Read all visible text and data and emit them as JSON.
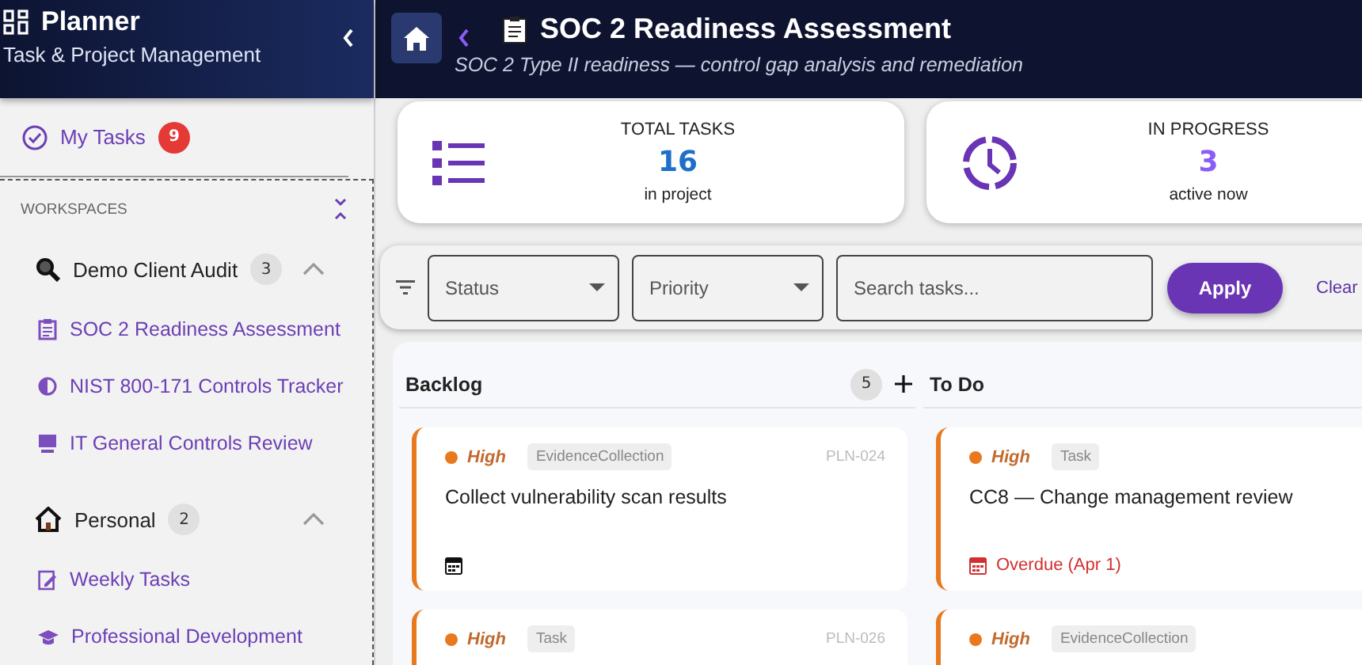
{
  "sidebar": {
    "title": "Planner",
    "subtitle": "Task & Project Management",
    "my_tasks": {
      "label": "My Tasks",
      "count": "9"
    },
    "section_label": "WORKSPACES",
    "workspaces": [
      {
        "name": "Demo Client Audit",
        "kind": "magnifier",
        "count": "3",
        "expanded": true,
        "children": [
          {
            "name": "SOC 2 Readiness Assessment",
            "kind": "clipboard"
          },
          {
            "name": "NIST 800-171 Controls Tracker",
            "kind": "half"
          },
          {
            "name": "IT General Controls Review",
            "kind": "monitor"
          }
        ]
      },
      {
        "name": "Personal",
        "kind": "house",
        "count": "2",
        "expanded": true,
        "children": [
          {
            "name": "Weekly Tasks",
            "kind": "edit"
          },
          {
            "name": "Professional Development",
            "kind": "cap"
          }
        ]
      }
    ]
  },
  "header": {
    "title": "SOC 2 Readiness Assessment",
    "subtitle": "SOC 2 Type II readiness — control gap analysis and remediation"
  },
  "stats": [
    {
      "kind": "list",
      "label": "TOTAL TASKS",
      "value": "16",
      "caption": "in project"
    },
    {
      "kind": "clock",
      "label": "IN PROGRESS",
      "value": "3",
      "caption": "active now"
    }
  ],
  "filters": {
    "status": {
      "placeholder": "Status"
    },
    "priority": {
      "placeholder": "Priority"
    },
    "search": {
      "placeholder": "Search tasks..."
    },
    "apply": "Apply",
    "clear": "Clear"
  },
  "columns": [
    {
      "title": "Backlog",
      "count": "5",
      "cards": [
        {
          "priority": "High",
          "tag": "EvidenceCollection",
          "id": "PLN-024",
          "title": "Collect vulnerability scan results",
          "kind": "dated"
        },
        {
          "priority": "High",
          "tag": "Task",
          "id": "PLN-026",
          "kind": "plain"
        }
      ]
    },
    {
      "title": "To Do",
      "cards": [
        {
          "priority": "High",
          "tag": "Task",
          "title": "CC8 — Change management review",
          "kind": "overdue",
          "due": "Overdue (Apr 1)"
        },
        {
          "priority": "High",
          "tag": "EvidenceCollection",
          "kind": "plain"
        }
      ]
    }
  ]
}
